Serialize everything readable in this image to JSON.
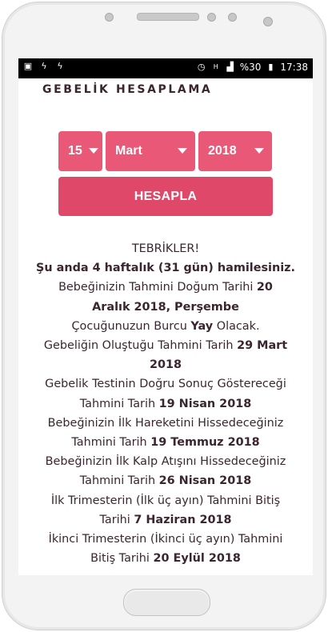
{
  "statusbar": {
    "left_icons": [
      "image-icon",
      "flash-icon",
      "flash-icon"
    ],
    "battery_percent": "%30",
    "time": "17:38"
  },
  "page": {
    "title": "GEBELİK HESAPLAMA",
    "selects": {
      "day": "15",
      "month": "Mart",
      "year": "2018"
    },
    "button": "HESAPLA",
    "result": {
      "congrats": "TEBRİKLER!",
      "weeks_line": "Şu anda 4 haftalık (31 gün) hamilesiniz.",
      "due_label": "Bebeğinizin Tahmini Doğum Tarihi ",
      "due_value": "20 Aralık 2018, Perşembe",
      "zodiac_pre": "Çocuğunuzun Burcu ",
      "zodiac_value": "Yay",
      "zodiac_post": " Olacak.",
      "conception_label": "Gebeliğin Oluştuğu Tahmini Tarih ",
      "conception_value": "29 Mart 2018",
      "test_label": "Gebelik Testinin Doğru Sonuç Göstereceği Tahmini Tarih ",
      "test_value": "19 Nisan 2018",
      "movement_label": "Bebeğinizin İlk Hareketini Hissedeceğiniz Tahmini Tarih ",
      "movement_value": "19 Temmuz 2018",
      "heartbeat_label": "Bebeğinizin İlk Kalp Atışını Hissedeceğiniz Tahmini Tarih ",
      "heartbeat_value": "26 Nisan 2018",
      "tri1_label": "İlk Trimesterin (İlk üç ayın) Tahmini Bitiş Tarihi ",
      "tri1_value": "7 Haziran 2018",
      "tri2_label": "İkinci Trimesterin (İkinci üç ayın) Tahmini Bitiş Tarihi ",
      "tri2_value": "20 Eylül 2018"
    }
  },
  "colors": {
    "accent": "#ea5878",
    "button": "#e0486a",
    "text": "#3a2630"
  }
}
